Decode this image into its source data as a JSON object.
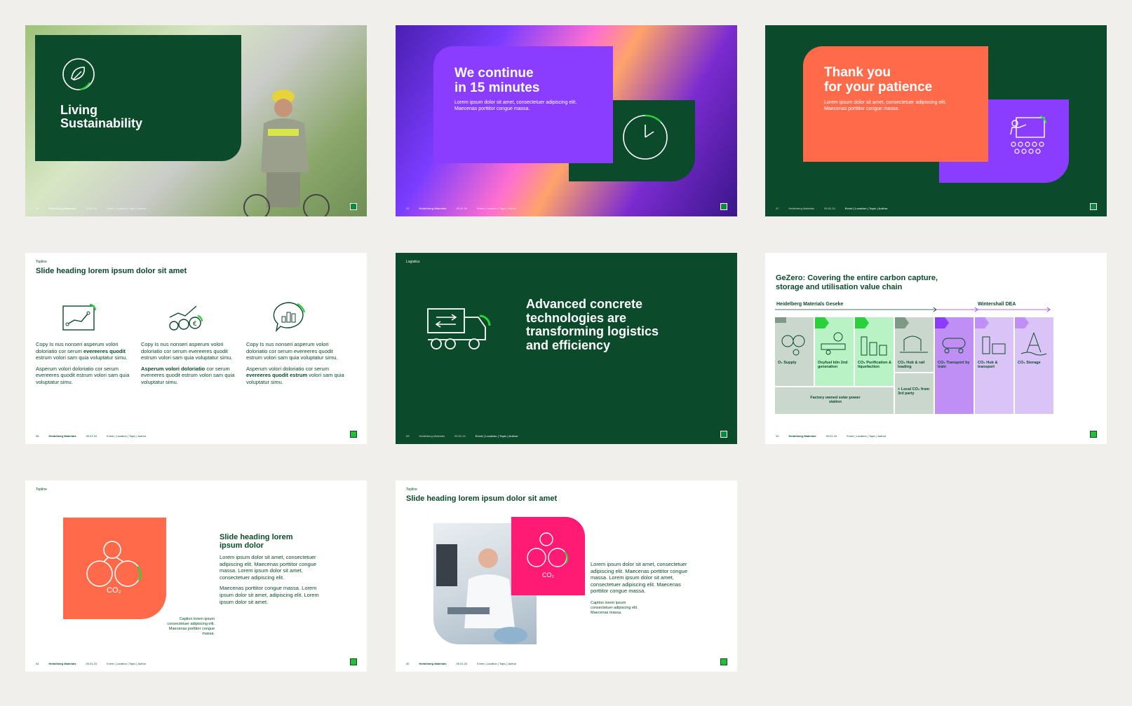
{
  "footer": {
    "page_s1": "05",
    "page_s2": "22",
    "page_s3": "47",
    "page_s4": "08",
    "page_s5": "09",
    "page_s6": "10",
    "page_s7": "04",
    "page_s8": "40",
    "brand": "Heidelberg Materials",
    "date": "09.01.24",
    "meta": "Event | Location | Topic | Author"
  },
  "s1": {
    "title_l1": "Living",
    "title_l2": "Sustainability"
  },
  "s2": {
    "title_l1": "We continue",
    "title_l2": "in 15 minutes",
    "body_l1": "Lorem ipsum dolor sit amet, consectetuer adipiscing elit.",
    "body_l2": "Maecenas porttitor congue massa."
  },
  "s3": {
    "title_l1": "Thank you",
    "title_l2": "for your patience",
    "body_l1": "Lorem ipsum dolor sit amet, consectetuer adipiscing elit.",
    "body_l2": "Maecenas porttitor congue massa."
  },
  "s4": {
    "topline": "Topline",
    "heading": "Slide heading lorem ipsum dolor sit amet",
    "col1_p1": "Copy Is nus nonseri asperum volori doloriatio cor serum ",
    "col1_p1b": "evereeres quodit",
    "col1_p1c": " estrum volori sam quia voluptatur simu.",
    "col1_p2": "Asperum volori doloriatio cor serum evereeres quodit estrum volori sam quia voluptatur simu.",
    "col2_p1": "Copy Is nus nonseri asperum volori doloriatio cor serum evereeres quodit estrum volori sam quia voluptatur simu.",
    "col2_p2b": "Asperum volori doloriatio",
    "col2_p2": " cor serum evereeres quodit estrum volori sam quia voluptatur simu.",
    "col3_p1": "Copy Is nus nonseri asperum volori doloriatio cor serum evereeres quodit estrum volori sam quia voluptatur simu.",
    "col3_p2": "Asperum volori doloriatio cor serum ",
    "col3_p2b": "evereeres quodit estrum",
    "col3_p2c": " volori sam quia voluptatur simu."
  },
  "s5": {
    "topline": "Logistics",
    "title_l1": "Advanced concrete",
    "title_l2": "technologies are",
    "title_l3": "transforming logistics",
    "title_l4": "and efficiency"
  },
  "s6": {
    "title_l1": "GeZero: Covering the entire carbon capture,",
    "title_l2": "storage and utilisation  value chain",
    "group1": "Heidelberg Materials Geseke",
    "group2": "Wintershall DEA",
    "steps": [
      "O₂ Supply",
      "Oxyfuel kiln 2nd generation",
      "CO₂ Purification & liquefaction",
      "CO₂ Hub & rail loading",
      "CO₂ Transport by train",
      "CO₂ Hub & transport",
      "CO₂ Storage"
    ],
    "solar": "Factory owned solar power station",
    "local": "+ Local CO₂ from 3rd party"
  },
  "s7": {
    "topline": "Topline",
    "heading_l1": "Slide heading lorem",
    "heading_l2": "ipsum dolor",
    "p1": "Lorem ipsum dolor sit amet, consectetuer adipiscing elit. Maecenas porttitor congue massa. Lorem ipsum dolor sit amet, consectetuer adipiscing elit.",
    "p2": "Maecenas porttitor congue massa. Lorem ipsum dolor sit amet, adipiscing elit. Lorem ipsum dolor sit amet.",
    "caption": "Caption lorem ipsum consectetuer adipiscing elit. Maecenas porttitor congue massa.",
    "co2": "CO₂"
  },
  "s8": {
    "topline": "Topline",
    "heading": "Slide heading lorem ipsum dolor sit amet",
    "p1": "Lorem ipsum dolor sit amet, consectetuer adipiscing elit. Maecenas porttitor congue massa. Lorem ipsum dolor sit amet, consectetuer adipiscing elit. Maecenas porttitor congue massa.",
    "caption": "Caption lorem ipsum consectetuer adipiscing elit. Maecenas massa.",
    "co2": "CO₂"
  },
  "colors": {
    "dark_green": "#0b4a2b",
    "bright_green": "#2bd13a",
    "purple": "#8a3dff",
    "coral": "#ff6a4a",
    "magenta": "#ff1a73"
  }
}
